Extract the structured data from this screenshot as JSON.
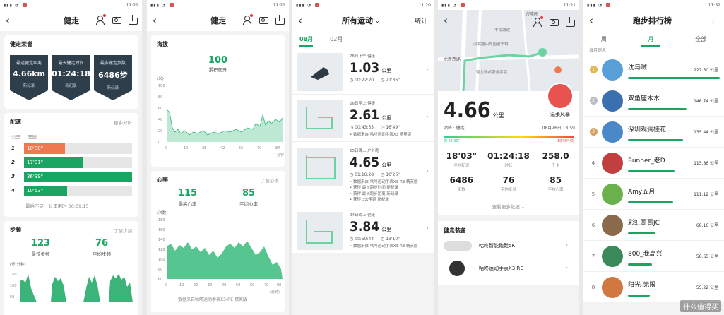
{
  "status_times": [
    "11:21",
    "11:21",
    "11:20",
    "11:21",
    "11:52"
  ],
  "p1": {
    "title": "健走",
    "honor": {
      "title": "健走荣誉",
      "badges": [
        {
          "label": "最远健走距离",
          "value": "4.66km",
          "note": "新纪录"
        },
        {
          "label": "最长健走时间",
          "value": "01:24:18",
          "note": "新纪录"
        },
        {
          "label": "最多健走步数",
          "value": "6486步",
          "note": "新纪录"
        }
      ]
    },
    "pace": {
      "title": "配速",
      "more": "更多分析",
      "col1": "公里",
      "col2": "配速",
      "rows": [
        {
          "n": "1",
          "value": "10'30\"",
          "fraction": 0.38,
          "color": "#f07850"
        },
        {
          "n": "2",
          "value": "17'01\"",
          "fraction": 0.55,
          "color": "#1aa662"
        },
        {
          "n": "3",
          "value": "36'39\"",
          "fraction": 1.0,
          "color": "#1aa662"
        },
        {
          "n": "4",
          "value": "10'53\"",
          "fraction": 0.4,
          "color": "#1aa662"
        }
      ],
      "note": "最后不足一公里用时 00:09:15"
    },
    "cadence": {
      "title": "步频",
      "more": "了解步频",
      "max": "123",
      "max_label": "最快步频",
      "avg": "76",
      "avg_label": "平均步频",
      "unit": "(步/分钟)",
      "ticks": [
        "150",
        "100",
        "50"
      ]
    }
  },
  "p2": {
    "title": "健走",
    "altitude": {
      "title": "海拔",
      "value": "100",
      "label": "累积爬升",
      "unit": "(米)",
      "yticks": [
        "100",
        "80",
        "60",
        "40",
        "20",
        "0"
      ],
      "xticks": [
        "0",
        "14",
        "28",
        "42",
        "56",
        "70",
        "84"
      ],
      "xunit": "分钟"
    },
    "heart": {
      "title": "心率",
      "more": "了解心率",
      "max": "115",
      "max_label": "最高心率",
      "avg": "85",
      "avg_label": "平均心率",
      "unit": "(次数)",
      "yticks": [
        "180",
        "160",
        "140",
        "120",
        "100",
        "80",
        "60"
      ],
      "xticks": [
        "0",
        "10",
        "20",
        "30",
        "40",
        "50",
        "60",
        "70",
        "80"
      ],
      "xunit": "(分钟)",
      "source": "数据来自咕咚运动手表X3-RE 精英版"
    }
  },
  "p3": {
    "title": "所有运动",
    "stats": "统计",
    "months": [
      "08月",
      "02月"
    ],
    "items": [
      {
        "date": "26日下午 健走",
        "dist": "1.03",
        "unit": "公里",
        "time": "00:22:20",
        "pace": "21'36\"",
        "notes": []
      },
      {
        "date": "26日早上 健走",
        "dist": "2.61",
        "unit": "公里",
        "time": "00:43:55",
        "pace": "16'49\"",
        "notes": [
          "数据来自 咕咚运动手表X3 精英版"
        ]
      },
      {
        "date": "25日晚上 户外跑",
        "dist": "4.65",
        "unit": "公里",
        "time": "01:16:28",
        "pace": "16'26\"",
        "notes": [
          "数据来自 咕咚运动手表X3-RE 精英版",
          "获得 最长跑步时间 新纪录",
          "获得 最长跑步距离 新纪录",
          "获得 3公里跑 新纪录"
        ]
      },
      {
        "date": "24日晚上 健走",
        "dist": "3.84",
        "unit": "公里",
        "time": "00:50:44",
        "pace": "13'10\"",
        "notes": [
          "数据来自 咕咚运动手表X3-RE 精英版"
        ]
      }
    ]
  },
  "p4": {
    "map_labels": [
      "兴隆园",
      "北新西路",
      "河北唐山外国语学校",
      "河北联邦服务学院",
      "丰南城建"
    ],
    "user": "温柔风暴",
    "distance": "4.66",
    "unit": "公里",
    "device": "咕咚 · 健走",
    "datetime": "08月26日 18:59",
    "pace_slow": "慢 36'39\"",
    "pace_fast": "10'30\" 快",
    "grid": [
      {
        "v": "18'03\"",
        "l": "平均配速"
      },
      {
        "v": "01:24:18",
        "l": "时长"
      },
      {
        "v": "258.0",
        "l": "千卡"
      },
      {
        "v": "6486",
        "l": "步数"
      },
      {
        "v": "76",
        "l": "平均步频"
      },
      {
        "v": "85",
        "l": "平均心率"
      }
    ],
    "more": "查看更多数据",
    "gear_title": "健走装备",
    "gear": [
      {
        "name": "咕咚智能跑鞋5K"
      },
      {
        "name": "咕咚运动手表X3 RE"
      }
    ]
  },
  "p5": {
    "title": "跑步排行榜",
    "tabs": [
      "周",
      "月",
      "全部"
    ],
    "partial": "当月跑风",
    "ranks": [
      {
        "rank": "1",
        "name": "沈乌贼",
        "value": "227.50 公里",
        "fraction": 1.0,
        "medal": "#e0b84c"
      },
      {
        "rank": "2",
        "name": "双鱼座木木",
        "value": "146.74 公里",
        "fraction": 0.64,
        "medal": "#b8bec6"
      },
      {
        "rank": "3",
        "name": "深圳观澜桂花...",
        "value": "135.44 公里",
        "fraction": 0.6,
        "medal": "#d8a060"
      },
      {
        "rank": "4",
        "name": "Runner_老D",
        "value": "115.86 公里",
        "fraction": 0.51,
        "medal": ""
      },
      {
        "rank": "5",
        "name": "Amy五月",
        "value": "111.12 公里",
        "fraction": 0.49,
        "medal": ""
      },
      {
        "rank": "6",
        "name": "彩虹哥哥JC",
        "value": "68.16 公里",
        "fraction": 0.3,
        "medal": ""
      },
      {
        "rank": "7",
        "name": "800_我高兴",
        "value": "58.65 公里",
        "fraction": 0.26,
        "medal": ""
      },
      {
        "rank": "8",
        "name": "阳光-无限",
        "value": "55.22 公里",
        "fraction": 0.24,
        "medal": ""
      }
    ],
    "watermark": "什么值得买"
  }
}
